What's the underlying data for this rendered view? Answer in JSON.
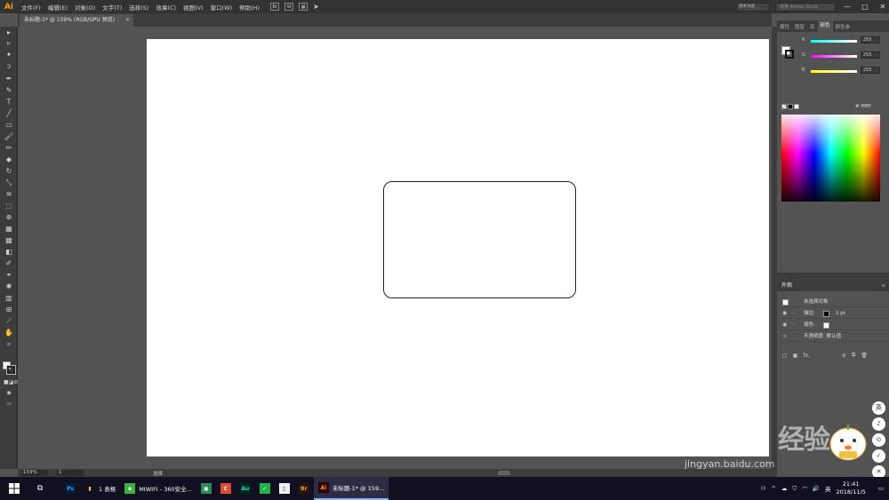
{
  "app": {
    "logo": "Ai",
    "menu": [
      "文件(F)",
      "编辑(E)",
      "对象(O)",
      "文字(T)",
      "选择(S)",
      "效果(C)",
      "视图(V)",
      "窗口(W)",
      "帮助(H)"
    ],
    "bridge_btn": "Br",
    "stock_btn": "St",
    "search_placeholder": "搜索 Adobe Stock",
    "workspace_label": "基本功能",
    "window_controls": [
      "—",
      "□",
      "✕"
    ]
  },
  "document": {
    "tab_title": "未标题-1* @ 159% (RGB/GPU 预览)",
    "tab_close": "×"
  },
  "statusbar": {
    "zoom": "159%",
    "page": "1",
    "tool": "选择"
  },
  "panels": {
    "tabs": [
      "属性",
      "图层",
      "库",
      "颜色",
      "颜色参"
    ],
    "active_tab": "颜色",
    "color": {
      "channels": [
        {
          "label": "R",
          "value": "255",
          "color": "#00c8ff"
        },
        {
          "label": "G",
          "value": "255",
          "color": "#ff00ff"
        },
        {
          "label": "B",
          "value": "255",
          "color": "#ffff00"
        }
      ],
      "hex_label": "#",
      "hex_value": "ffffff"
    },
    "appearance": {
      "title": "外观",
      "menu": "≡",
      "object": "未选择对象",
      "stroke_label": "描边:",
      "stroke_value": "1 pt",
      "fill_label": "填色:",
      "opacity_label": "不透明度: 默认值",
      "footer_icons": [
        "□",
        "▣",
        "fx.",
        "⊘",
        "⧉",
        "🗑"
      ]
    }
  },
  "watermark": {
    "logo": "Bai du 经验",
    "url": "jingyan.baidu.com"
  },
  "side_buttons": [
    "英",
    "♪",
    "⊙",
    "✓",
    "✕"
  ],
  "taskbar": {
    "apps": [
      {
        "icon": "Ps",
        "label": "",
        "color": "#31a8ff",
        "bg": "#001e36"
      },
      {
        "icon": "▮",
        "label": "1 表格",
        "color": "#f5c542",
        "bg": "transparent"
      },
      {
        "icon": "e",
        "label": "MIWIFI - 360安全...",
        "color": "#ffffff",
        "bg": "#3cb043"
      },
      {
        "icon": "▣",
        "label": "",
        "color": "#ffffff",
        "bg": "#2e8b57"
      },
      {
        "icon": "C",
        "label": "",
        "color": "#ffffff",
        "bg": "#e04a2f"
      },
      {
        "icon": "Au",
        "label": "",
        "color": "#00e4bb",
        "bg": "#00251f"
      },
      {
        "icon": "✓",
        "label": "",
        "color": "#ffffff",
        "bg": "#22b14c"
      },
      {
        "icon": "▯",
        "label": "",
        "color": "#333333",
        "bg": "#f0f0f0"
      },
      {
        "icon": "Br",
        "label": "",
        "color": "#e8a14b",
        "bg": "#2b1500"
      },
      {
        "icon": "Ai",
        "label": "未标题-1* @ 159...",
        "color": "#ff9a00",
        "bg": "#330000"
      }
    ],
    "tray_lang": "英",
    "time": "21:41",
    "date": "2018/11/5"
  }
}
